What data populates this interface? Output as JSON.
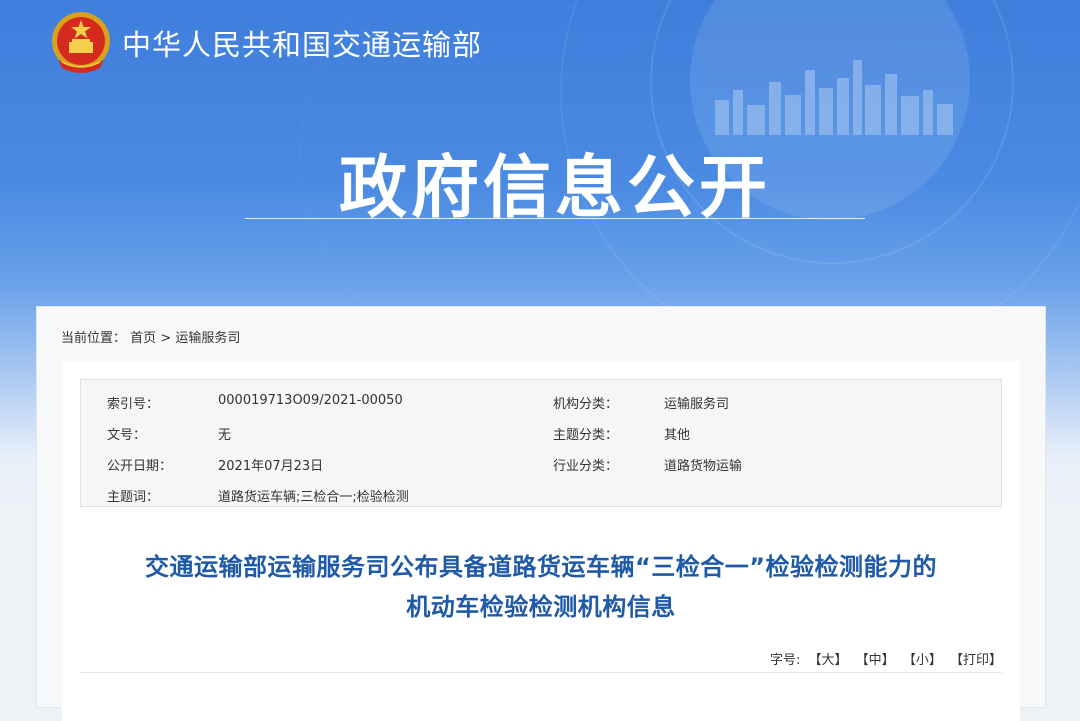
{
  "header": {
    "site_title": "中华人民共和国交通运输部",
    "emblem_icon": "national-emblem-icon",
    "hero_title": "政府信息公开",
    "colors": {
      "banner_blue": "#3f7fdc",
      "title_blue": "#1f5aa8"
    }
  },
  "breadcrumb": {
    "prefix": "当前位置：",
    "home": "首页",
    "separator": ">",
    "current": "运输服务司"
  },
  "meta": {
    "rows": [
      {
        "label1": "索引号：",
        "value1": "000019713O09/2021-00050",
        "label2": "机构分类：",
        "value2": "运输服务司"
      },
      {
        "label1": "文号：",
        "value1": "无",
        "label2": "主题分类：",
        "value2": "其他"
      },
      {
        "label1": "公开日期：",
        "value1": "2021年07月23日",
        "label2": "行业分类：",
        "value2": "道路货物运输"
      },
      {
        "label1": "主题词：",
        "value1": "道路货运车辆;三检合一;检验检测",
        "label2": "",
        "value2": ""
      }
    ]
  },
  "article": {
    "title_line1": "交通运输部运输服务司公布具备道路货运车辆“三检合一”检验检测能力的",
    "title_line2": "机动车检验检测机构信息"
  },
  "font_tools": {
    "label": "字号:",
    "large": "【大】",
    "medium": "【中】",
    "small": "【小】",
    "print": "【打印】"
  }
}
